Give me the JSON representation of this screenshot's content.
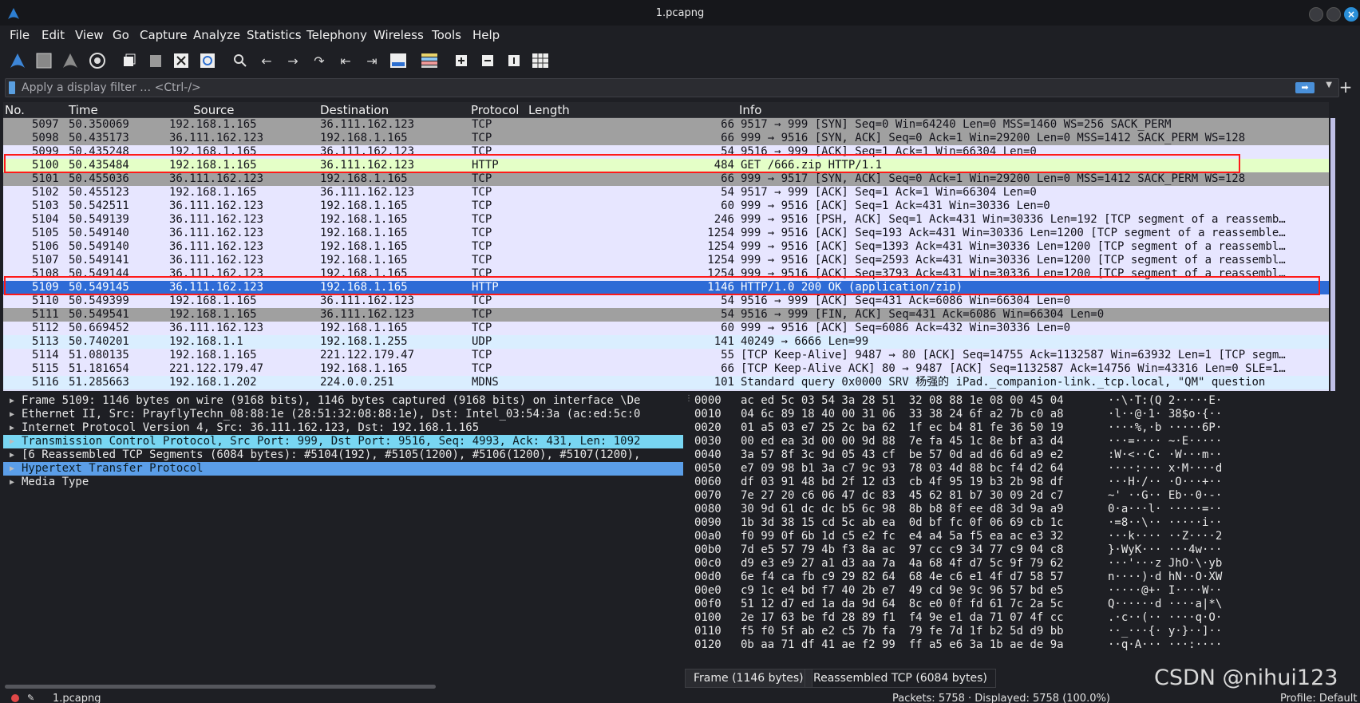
{
  "window": {
    "title": "1.pcapng"
  },
  "menu": [
    "File",
    "Edit",
    "View",
    "Go",
    "Capture",
    "Analyze",
    "Statistics",
    "Telephony",
    "Wireless",
    "Tools",
    "Help"
  ],
  "filter": {
    "placeholder": "Apply a display filter … <Ctrl-/>"
  },
  "columns": {
    "no": "No.",
    "time": "Time",
    "source": "Source",
    "destination": "Destination",
    "protocol": "Protocol",
    "length": "Length",
    "info": "Info"
  },
  "packets": [
    {
      "no": "5097",
      "time": "50.350069",
      "src": "192.168.1.165",
      "dst": "36.111.162.123",
      "proto": "TCP",
      "len": "66",
      "info": "9517 → 999 [SYN] Seq=0 Win=64240 Len=0 MSS=1460 WS=256 SACK_PERM",
      "style": "tcpgray"
    },
    {
      "no": "5098",
      "time": "50.435173",
      "src": "36.111.162.123",
      "dst": "192.168.1.165",
      "proto": "TCP",
      "len": "66",
      "info": "999 → 9516 [SYN, ACK] Seq=0 Ack=1 Win=29200 Len=0 MSS=1412 SACK_PERM WS=128",
      "style": "tcpgray"
    },
    {
      "no": "5099",
      "time": "50.435248",
      "src": "192.168.1.165",
      "dst": "36.111.162.123",
      "proto": "TCP",
      "len": "54",
      "info": "9516 → 999 [ACK] Seq=1 Ack=1 Win=66304 Len=0",
      "style": "tcp"
    },
    {
      "no": "5100",
      "time": "50.435484",
      "src": "192.168.1.165",
      "dst": "36.111.162.123",
      "proto": "HTTP",
      "len": "484",
      "info": "GET /666.zip HTTP/1.1",
      "style": "http"
    },
    {
      "no": "5101",
      "time": "50.455036",
      "src": "36.111.162.123",
      "dst": "192.168.1.165",
      "proto": "TCP",
      "len": "66",
      "info": "999 → 9517 [SYN, ACK] Seq=0 Ack=1 Win=29200 Len=0 MSS=1412 SACK_PERM WS=128",
      "style": "tcpgray"
    },
    {
      "no": "5102",
      "time": "50.455123",
      "src": "192.168.1.165",
      "dst": "36.111.162.123",
      "proto": "TCP",
      "len": "54",
      "info": "9517 → 999 [ACK] Seq=1 Ack=1 Win=66304 Len=0",
      "style": "tcp"
    },
    {
      "no": "5103",
      "time": "50.542511",
      "src": "36.111.162.123",
      "dst": "192.168.1.165",
      "proto": "TCP",
      "len": "60",
      "info": "999 → 9516 [ACK] Seq=1 Ack=431 Win=30336 Len=0",
      "style": "tcp"
    },
    {
      "no": "5104",
      "time": "50.549139",
      "src": "36.111.162.123",
      "dst": "192.168.1.165",
      "proto": "TCP",
      "len": "246",
      "info": "999 → 9516 [PSH, ACK] Seq=1 Ack=431 Win=30336 Len=192 [TCP segment of a reassemb…",
      "style": "tcp"
    },
    {
      "no": "5105",
      "time": "50.549140",
      "src": "36.111.162.123",
      "dst": "192.168.1.165",
      "proto": "TCP",
      "len": "1254",
      "info": "999 → 9516 [ACK] Seq=193 Ack=431 Win=30336 Len=1200 [TCP segment of a reassemble…",
      "style": "tcp"
    },
    {
      "no": "5106",
      "time": "50.549140",
      "src": "36.111.162.123",
      "dst": "192.168.1.165",
      "proto": "TCP",
      "len": "1254",
      "info": "999 → 9516 [ACK] Seq=1393 Ack=431 Win=30336 Len=1200 [TCP segment of a reassembl…",
      "style": "tcp"
    },
    {
      "no": "5107",
      "time": "50.549141",
      "src": "36.111.162.123",
      "dst": "192.168.1.165",
      "proto": "TCP",
      "len": "1254",
      "info": "999 → 9516 [ACK] Seq=2593 Ack=431 Win=30336 Len=1200 [TCP segment of a reassembl…",
      "style": "tcp"
    },
    {
      "no": "5108",
      "time": "50.549144",
      "src": "36.111.162.123",
      "dst": "192.168.1.165",
      "proto": "TCP",
      "len": "1254",
      "info": "999 → 9516 [ACK] Seq=3793 Ack=431 Win=30336 Len=1200 [TCP segment of a reassembl…",
      "style": "tcp"
    },
    {
      "no": "5109",
      "time": "50.549145",
      "src": "36.111.162.123",
      "dst": "192.168.1.165",
      "proto": "HTTP",
      "len": "1146",
      "info": "HTTP/1.0 200 OK  (application/zip)",
      "style": "sel"
    },
    {
      "no": "5110",
      "time": "50.549399",
      "src": "192.168.1.165",
      "dst": "36.111.162.123",
      "proto": "TCP",
      "len": "54",
      "info": "9516 → 999 [ACK] Seq=431 Ack=6086 Win=66304 Len=0",
      "style": "tcp"
    },
    {
      "no": "5111",
      "time": "50.549541",
      "src": "192.168.1.165",
      "dst": "36.111.162.123",
      "proto": "TCP",
      "len": "54",
      "info": "9516 → 999 [FIN, ACK] Seq=431 Ack=6086 Win=66304 Len=0",
      "style": "tcpgray"
    },
    {
      "no": "5112",
      "time": "50.669452",
      "src": "36.111.162.123",
      "dst": "192.168.1.165",
      "proto": "TCP",
      "len": "60",
      "info": "999 → 9516 [ACK] Seq=6086 Ack=432 Win=30336 Len=0",
      "style": "tcp"
    },
    {
      "no": "5113",
      "time": "50.740201",
      "src": "192.168.1.1",
      "dst": "192.168.1.255",
      "proto": "UDP",
      "len": "141",
      "info": "40249 → 6666 Len=99",
      "style": "udp"
    },
    {
      "no": "5114",
      "time": "51.080135",
      "src": "192.168.1.165",
      "dst": "221.122.179.47",
      "proto": "TCP",
      "len": "55",
      "info": "[TCP Keep-Alive] 9487 → 80 [ACK] Seq=14755 Ack=1132587 Win=63932 Len=1 [TCP segm…",
      "style": "tcp"
    },
    {
      "no": "5115",
      "time": "51.181654",
      "src": "221.122.179.47",
      "dst": "192.168.1.165",
      "proto": "TCP",
      "len": "66",
      "info": "[TCP Keep-Alive ACK] 80 → 9487 [ACK] Seq=1132587 Ack=14756 Win=43316 Len=0 SLE=1…",
      "style": "tcp"
    },
    {
      "no": "5116",
      "time": "51.285663",
      "src": "192.168.1.202",
      "dst": "224.0.0.251",
      "proto": "MDNS",
      "len": "101",
      "info": "Standard query 0x0000 SRV 杨强的 iPad._companion-link._tcp.local, \"QM\" question",
      "style": "mdns"
    }
  ],
  "details": [
    {
      "text": "Frame 5109: 1146 bytes on wire (9168 bits), 1146 bytes captured (9168 bits) on interface \\De",
      "style": ""
    },
    {
      "text": "Ethernet II, Src: PrayflyTechn_08:88:1e (28:51:32:08:88:1e), Dst: Intel_03:54:3a (ac:ed:5c:0",
      "style": ""
    },
    {
      "text": "Internet Protocol Version 4, Src: 36.111.162.123, Dst: 192.168.1.165",
      "style": ""
    },
    {
      "text": "Transmission Control Protocol, Src Port: 999, Dst Port: 9516, Seq: 4993, Ack: 431, Len: 1092",
      "style": "hl1"
    },
    {
      "text": "[6 Reassembled TCP Segments (6084 bytes): #5104(192), #5105(1200), #5106(1200), #5107(1200),",
      "style": ""
    },
    {
      "text": "Hypertext Transfer Protocol",
      "style": "hl2"
    },
    {
      "text": "Media Type",
      "style": ""
    }
  ],
  "hex": [
    {
      "off": "0000",
      "bytes": "ac ed 5c 03 54 3a 28 51  32 08 88 1e 08 00 45 04",
      "ascii": "··\\·T:(Q 2·····E·"
    },
    {
      "off": "0010",
      "bytes": "04 6c 89 18 40 00 31 06  33 38 24 6f a2 7b c0 a8",
      "ascii": "·l··@·1· 38$o·{··"
    },
    {
      "off": "0020",
      "bytes": "01 a5 03 e7 25 2c ba 62  1f ec b4 81 fe 36 50 19",
      "ascii": "····%,·b ·····6P·"
    },
    {
      "off": "0030",
      "bytes": "00 ed ea 3d 00 00 9d 88  7e fa 45 1c 8e bf a3 d4",
      "ascii": "···=···· ~·E·····"
    },
    {
      "off": "0040",
      "bytes": "3a 57 8f 3c 9d 05 43 cf  be 57 0d ad d6 6d a9 e2",
      "ascii": ":W·<··C· ·W···m··"
    },
    {
      "off": "0050",
      "bytes": "e7 09 98 b1 3a c7 9c 93  78 03 4d 88 bc f4 d2 64",
      "ascii": "····:··· x·M····d"
    },
    {
      "off": "0060",
      "bytes": "df 03 91 48 bd 2f 12 d3  cb 4f 95 19 b3 2b 98 df",
      "ascii": "···H·/·· ·O···+··"
    },
    {
      "off": "0070",
      "bytes": "7e 27 20 c6 06 47 dc 83  45 62 81 b7 30 09 2d c7",
      "ascii": "~' ··G·· Eb··0·-·"
    },
    {
      "off": "0080",
      "bytes": "30 9d 61 dc dc b5 6c 98  8b b8 8f ee d8 3d 9a a9",
      "ascii": "0·a···l· ·····=··"
    },
    {
      "off": "0090",
      "bytes": "1b 3d 38 15 cd 5c ab ea  0d bf fc 0f 06 69 cb 1c",
      "ascii": "·=8··\\·· ·····i··"
    },
    {
      "off": "00a0",
      "bytes": "f0 99 0f 6b 1d c5 e2 fc  e4 a4 5a f5 ea ac e3 32",
      "ascii": "···k···· ··Z····2"
    },
    {
      "off": "00b0",
      "bytes": "7d e5 57 79 4b f3 8a ac  97 cc c9 34 77 c9 04 c8",
      "ascii": "}·WyK··· ···4w···"
    },
    {
      "off": "00c0",
      "bytes": "d9 e3 e9 27 a1 d3 aa 7a  4a 68 4f d7 5c 9f 79 62",
      "ascii": "···'···z JhO·\\·yb"
    },
    {
      "off": "00d0",
      "bytes": "6e f4 ca fb c9 29 82 64  68 4e c6 e1 4f d7 58 57",
      "ascii": "n····)·d hN··O·XW"
    },
    {
      "off": "00e0",
      "bytes": "c9 1c e4 bd f7 40 2b e7  49 cd 9e 9c 96 57 bd e5",
      "ascii": "·····@+· I····W··"
    },
    {
      "off": "00f0",
      "bytes": "51 12 d7 ed 1a da 9d 64  8c e0 0f fd 61 7c 2a 5c",
      "ascii": "Q······d ····a|*\\"
    },
    {
      "off": "0100",
      "bytes": "2e 17 63 be fd 28 89 f1  f4 9e e1 da 71 07 4f cc",
      "ascii": ".·c··(·· ····q·O·"
    },
    {
      "off": "0110",
      "bytes": "f5 f0 5f ab e2 c5 7b fa  79 fe 7d 1f b2 5d d9 bb",
      "ascii": "··_···{· y·}··]··"
    },
    {
      "off": "0120",
      "bytes": "0b aa 71 df 41 ae f2 99  ff a5 e6 3a 1b ae de 9a",
      "ascii": "··q·A··· ···:····"
    }
  ],
  "hex_tabs": [
    "Frame (1146 bytes)",
    "Reassembled TCP (6084 bytes)"
  ],
  "watermark": "CSDN @nihui123",
  "status": {
    "file": "1.pcapng",
    "packets": "Packets: 5758 · Displayed: 5758 (100.0%)",
    "profile": "Profile: Default"
  }
}
